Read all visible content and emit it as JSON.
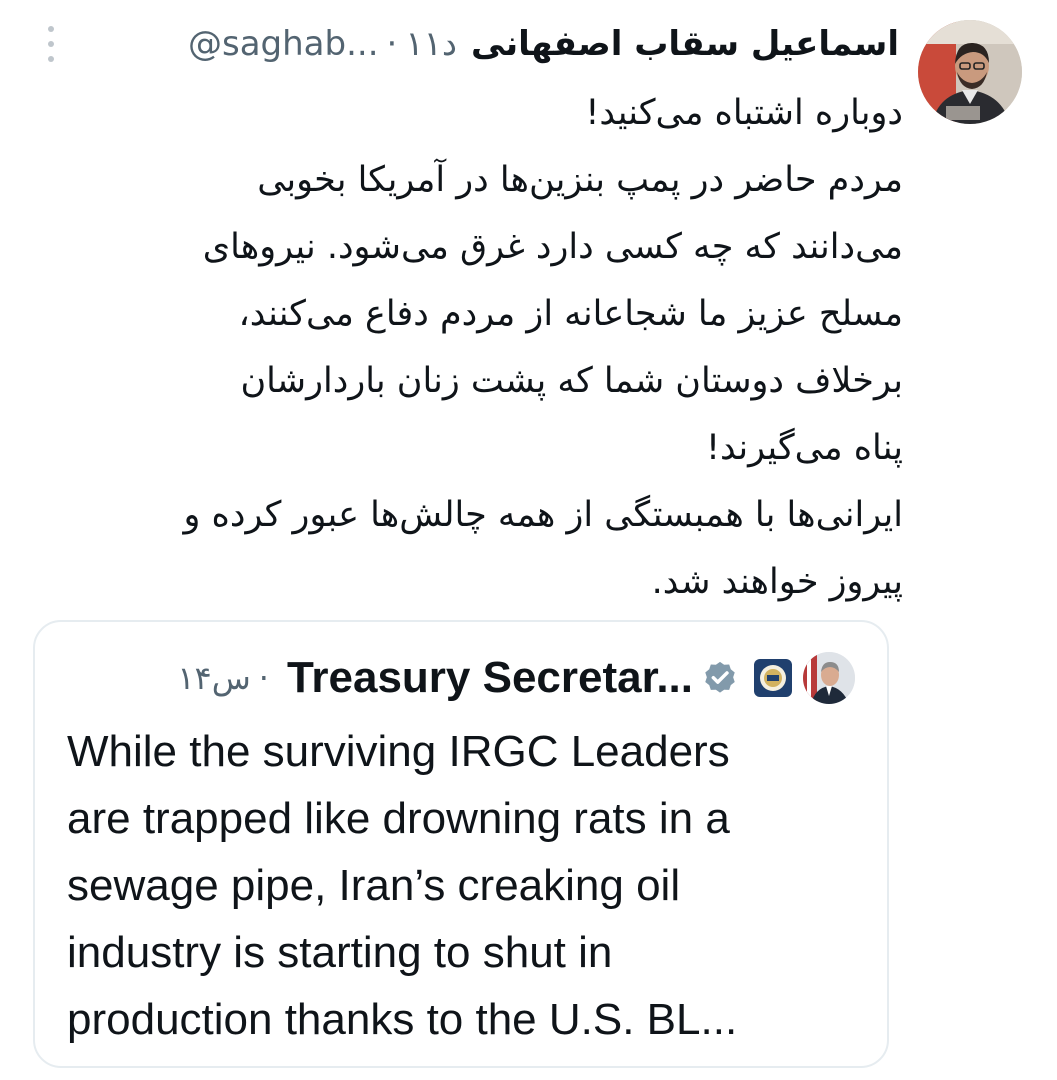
{
  "author": {
    "name": "اسماعیل سقاب اصفهانی",
    "handle": "@saghab...",
    "time": "۱۱د"
  },
  "tweet_lines": [
    "دوباره اشتباه می‌کنید!",
    "مردم حاضر در پمپ بنزین‌ها در آمریکا بخوبی",
    "می‌دانند که چه کسی دارد غرق می‌شود. نیروهای",
    "مسلح عزیز ما شجاعانه از مردم دفاع می‌کنند،",
    "برخلاف دوستان شما که پشت زنان باردارشان",
    "پناه می‌گیرند!",
    "ایرانی‌ها با همبستگی از همه چالش‌ها عبور کرده و",
    "پیروز خواهند شد."
  ],
  "quote": {
    "author_name": "Treasury Secretar...",
    "time": "۱۴س",
    "lines": [
      "While the surviving IRGC Leaders",
      "are trapped like drowning rats in a",
      "sewage pipe, Iran’s creaking oil",
      "industry is starting to shut in",
      "production thanks to the U.S. BL..."
    ]
  },
  "separator": "·",
  "colors": {
    "text": "#0f1419",
    "secondary": "#536471",
    "verified": "#829aab",
    "border": "#e6ecf0"
  },
  "icons": {
    "more": "more-vertical-icon",
    "verified": "verified-badge-icon",
    "org_badge": "treasury-seal-icon"
  }
}
